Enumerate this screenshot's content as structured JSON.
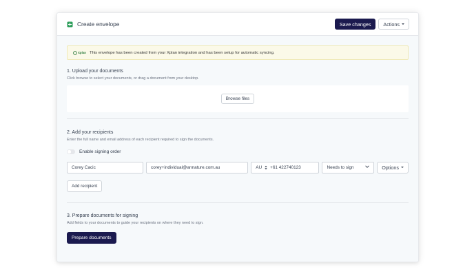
{
  "header": {
    "title": "Create envelope",
    "save_label": "Save changes",
    "actions_label": "Actions"
  },
  "alert": {
    "logo_text": "Xplan",
    "message": "This envelope has been created from your Xplan integration and has been setup for automatic syncing."
  },
  "upload": {
    "title": "1. Upload your documents",
    "description": "Click browse to select your documents, or drag a document from your desktop.",
    "browse_label": "Browse files"
  },
  "recipients": {
    "title": "2. Add your recipients",
    "description": "Enter the full name and email address of each recipient required to sign the documents.",
    "signing_order_label": "Enable signing order",
    "signing_order_enabled": false,
    "row": {
      "name": "Corey Cacic",
      "email": "corey+individual@annature.com.au",
      "country": "AU",
      "phone": "+61 422740123",
      "role": "Needs to sign",
      "options_label": "Options"
    },
    "add_label": "Add recipient"
  },
  "prepare": {
    "title": "3. Prepare documents for signing",
    "description": "Add fields to your documents to guide your recipients on where they need to sign.",
    "button_label": "Prepare documents"
  },
  "colors": {
    "primary": "#1b1a4f",
    "alert_bg": "#fbf9e8",
    "card_bg": "#f6f9fb",
    "icon_green": "#2e9e5b"
  }
}
